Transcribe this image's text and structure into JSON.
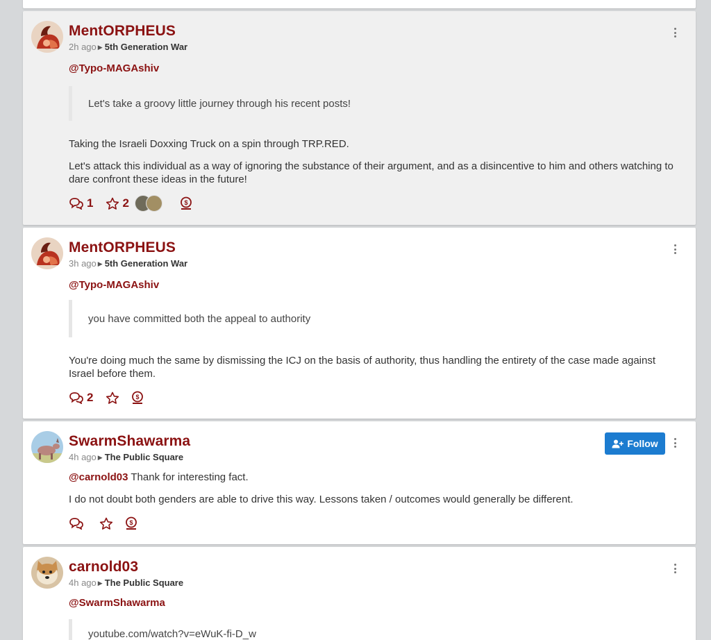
{
  "colors": {
    "username": "#8b1212",
    "accent": "#8b1212",
    "follow_button": "#1c7cd0",
    "highlight_card": "#f0f0f0"
  },
  "icons": {
    "comment": "comment-bubbles-icon",
    "star": "star-outline-icon",
    "tip": "coin-tip-icon",
    "more": "vertical-ellipsis-icon",
    "follow": "user-plus-icon"
  },
  "posts": [
    {
      "username": "MentORPHEUS",
      "time": "2h ago",
      "community": "5th Generation War",
      "mention": "@Typo-MAGAshiv",
      "quote": "Let's take a groovy little journey through his recent posts!",
      "paragraphs": [
        "Taking the Israeli Doxxing Truck on a spin through TRP.RED.",
        "Let's attack this individual as a way of ignoring the substance of their argument, and as a disincentive to him and others watching to dare confront these ideas in the future!"
      ],
      "comments": "1",
      "stars": "2"
    },
    {
      "username": "MentORPHEUS",
      "time": "3h ago",
      "community": "5th Generation War",
      "mention": "@Typo-MAGAshiv",
      "quote": "you have committed both the appeal to authority",
      "paragraphs": [
        "You're doing much the same by dismissing the ICJ on the basis of authority, thus handling the entirety of the case made against Israel before them."
      ],
      "comments": "2",
      "stars": ""
    },
    {
      "username": "SwarmShawarma",
      "time": "4h ago",
      "community": "The Public Square",
      "mention": "@carnold03",
      "mention_text": " Thank for interesting fact.",
      "paragraphs": [
        "I do not doubt both genders are able to drive this way. Lessons taken / outcomes would generally be different."
      ],
      "follow_label": "Follow",
      "comments": "",
      "stars": ""
    },
    {
      "username": "carnold03",
      "time": "4h ago",
      "community": "The Public Square",
      "mention": "@SwarmShawarma",
      "quote": "youtube.com/watch?v=eWuK-fi-D_w"
    }
  ]
}
